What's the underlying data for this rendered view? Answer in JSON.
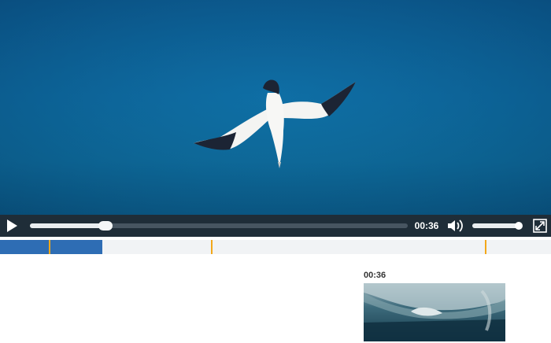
{
  "player": {
    "current_time": "00:36",
    "played_fraction": 0.2,
    "volume_fraction": 0.95,
    "chapter_fill_fraction": 0.186,
    "chapter_markers_fraction": [
      0.088,
      0.383,
      0.88
    ],
    "preview_time": "00:36",
    "colors": {
      "control_bar": "#1f2d38",
      "chapter_fill": "#2e6db4",
      "chapter_marker": "#f3a81a"
    }
  },
  "icons": {
    "play": "play-icon",
    "volume": "volume-icon",
    "fullscreen": "fullscreen-icon"
  }
}
